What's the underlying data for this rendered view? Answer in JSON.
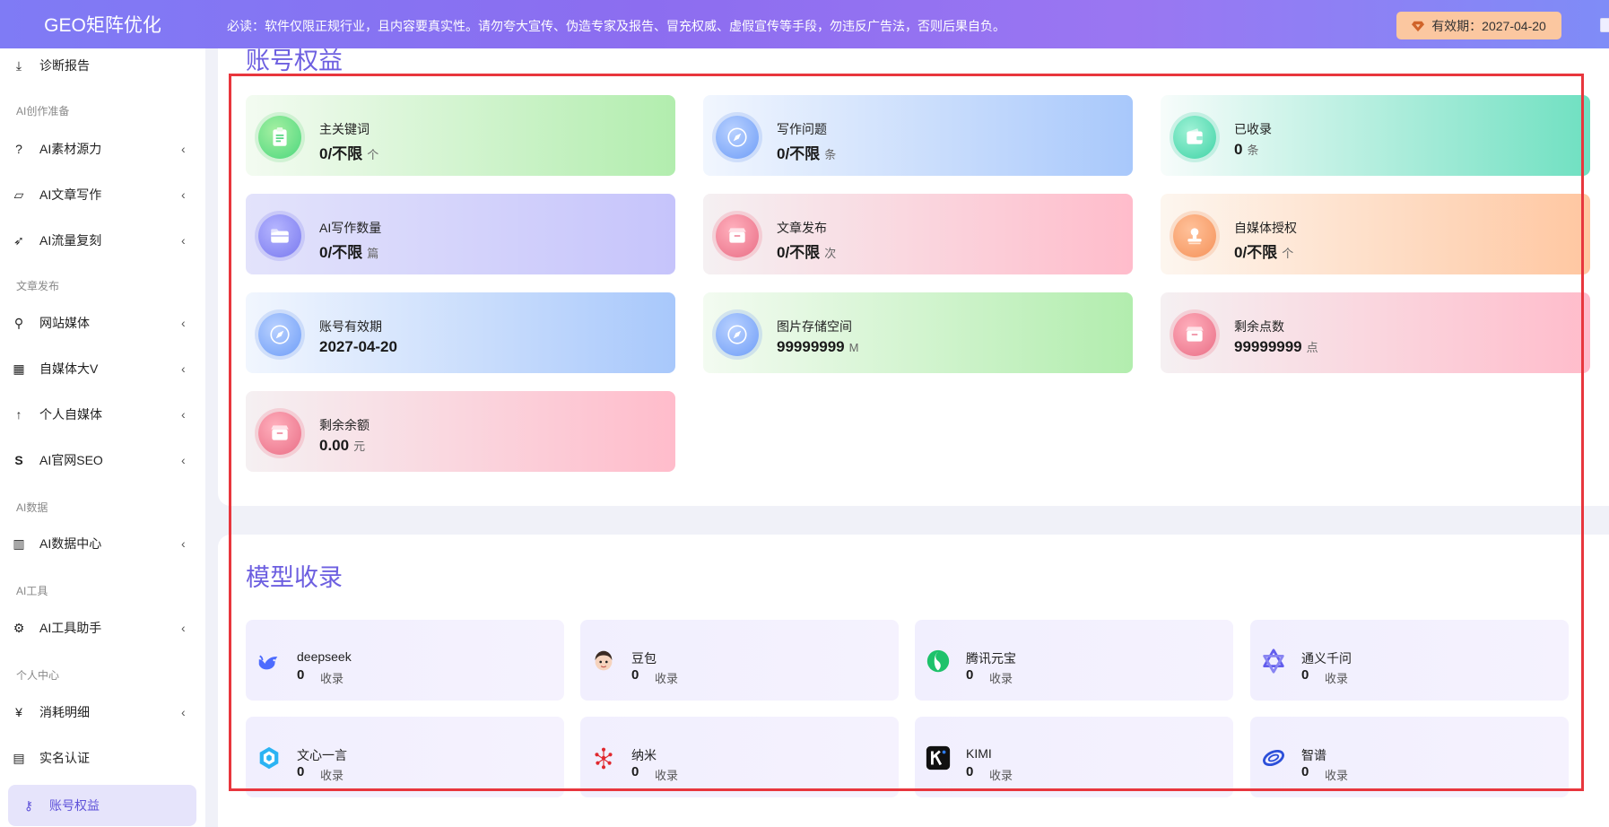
{
  "header": {
    "brand": "GEO矩阵优化",
    "notice": "必读：软件仅限正规行业，且内容要真实性。请勿夸大宣传、伪造专家及报告、冒充权威、虚假宣传等手段，勿违反广告法，否则后果自负。",
    "expiry_label": "有效期：2027-04-20"
  },
  "sidebar": {
    "top_item": "诊断报告",
    "sections": [
      "AI创作准备",
      "文章发布",
      "AI数据",
      "AI工具",
      "个人中心"
    ],
    "items": [
      {
        "label": "AI素材源力",
        "icon": "question-circle-icon"
      },
      {
        "label": "AI文章写作",
        "icon": "folder-open-icon"
      },
      {
        "label": "AI流量复刻",
        "icon": "rocket-icon"
      },
      {
        "label": "网站媒体",
        "icon": "search-icon"
      },
      {
        "label": "自媒体大V",
        "icon": "grid-icon"
      },
      {
        "label": "个人自媒体",
        "icon": "arrow-up-icon"
      },
      {
        "label": "AI官网SEO",
        "icon": "dollar-s-icon"
      },
      {
        "label": "AI数据中心",
        "icon": "bar-chart-icon"
      },
      {
        "label": "AI工具助手",
        "icon": "gear-icon"
      },
      {
        "label": "消耗明细",
        "icon": "yen-icon"
      },
      {
        "label": "实名认证",
        "icon": "id-card-icon"
      },
      {
        "label": "账号权益",
        "icon": "key-icon"
      }
    ]
  },
  "rights": {
    "title": "账号权益",
    "cards": [
      {
        "title": "主关键词",
        "value": "0/不限",
        "unit": "个"
      },
      {
        "title": "写作问题",
        "value": "0/不限",
        "unit": "条"
      },
      {
        "title": "已收录",
        "value": "0",
        "unit": "条"
      },
      {
        "title": "AI写作数量",
        "value": "0/不限",
        "unit": "篇"
      },
      {
        "title": "文章发布",
        "value": "0/不限",
        "unit": "次"
      },
      {
        "title": "自媒体授权",
        "value": "0/不限",
        "unit": "个"
      },
      {
        "title": "账号有效期",
        "value": "2027-04-20",
        "unit": ""
      },
      {
        "title": "图片存储空间",
        "value": "99999999",
        "unit": "M"
      },
      {
        "title": "剩余点数",
        "value": "99999999",
        "unit": "点"
      },
      {
        "title": "剩余余额",
        "value": "0.00",
        "unit": "元"
      }
    ]
  },
  "models": {
    "title": "模型收录",
    "unit": "收录",
    "items": [
      {
        "name": "deepseek",
        "value": "0",
        "icon": "deepseek-whale-icon"
      },
      {
        "name": "豆包",
        "value": "0",
        "icon": "doubao-avatar-icon"
      },
      {
        "name": "腾讯元宝",
        "value": "0",
        "icon": "yuanbao-icon"
      },
      {
        "name": "通义千问",
        "value": "0",
        "icon": "tongyi-icon"
      },
      {
        "name": "文心一言",
        "value": "0",
        "icon": "wenxin-icon"
      },
      {
        "name": "纳米",
        "value": "0",
        "icon": "nami-icon"
      },
      {
        "name": "KIMI",
        "value": "0",
        "icon": "kimi-icon"
      },
      {
        "name": "智谱",
        "value": "0",
        "icon": "zhipu-icon"
      }
    ]
  }
}
